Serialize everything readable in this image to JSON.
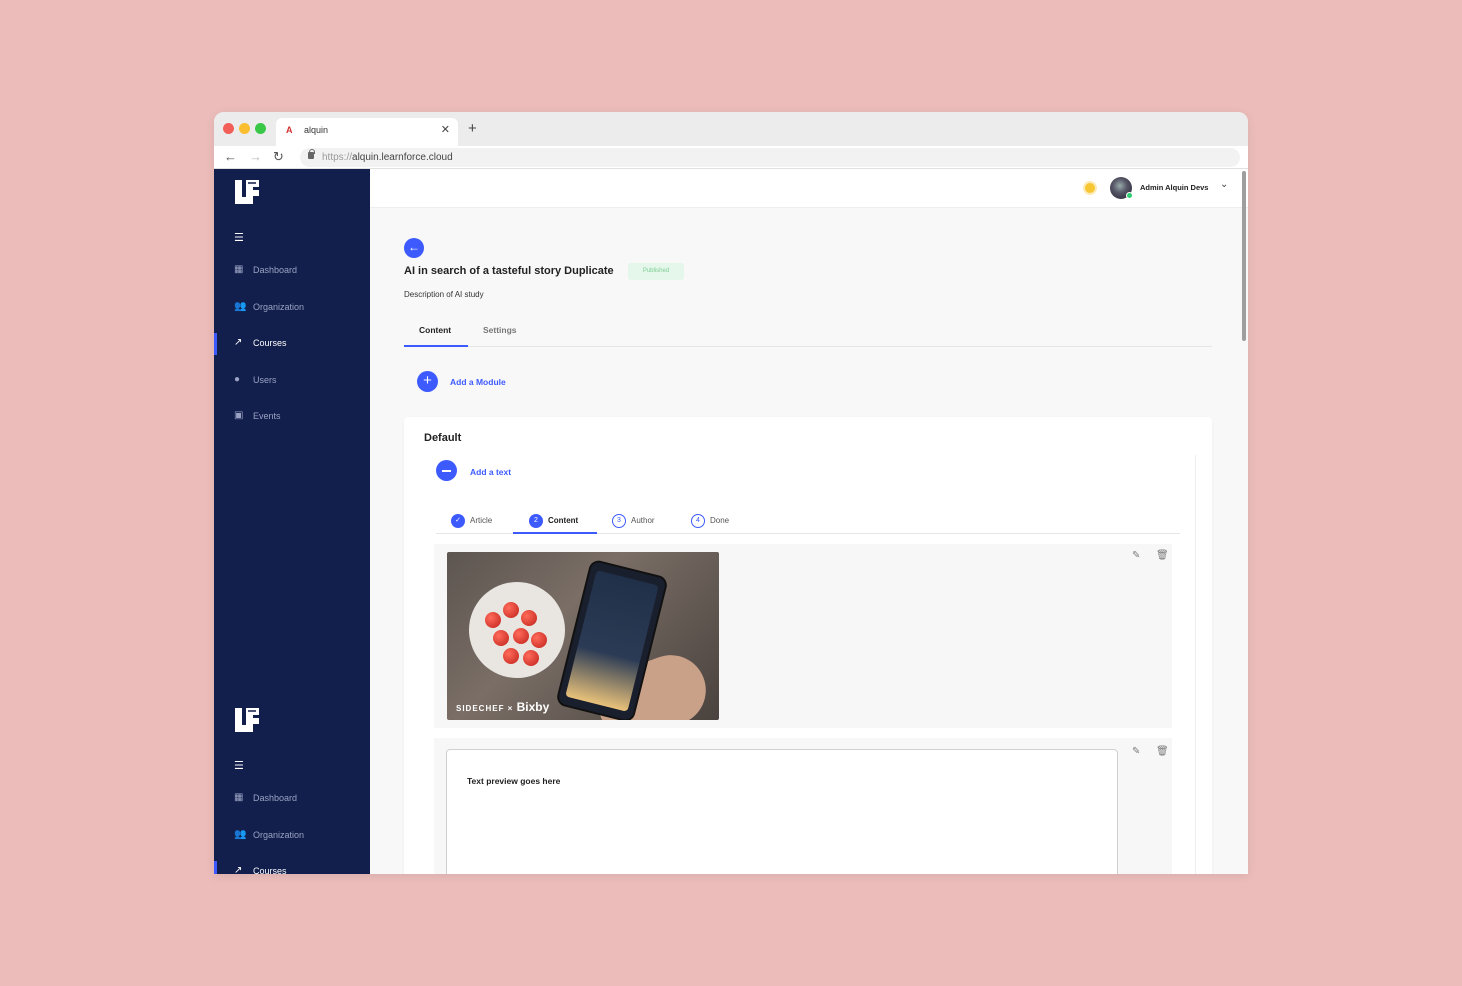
{
  "browser": {
    "tab_title": "alquin",
    "tab_favicon": "A",
    "url_protocol": "https://",
    "url_host": "alquin.learnforce.cloud"
  },
  "sidebar": {
    "items": [
      {
        "label": "Dashboard",
        "icon": "dashboard-icon"
      },
      {
        "label": "Organization",
        "icon": "people-icon"
      },
      {
        "label": "Courses",
        "icon": "trending-icon"
      },
      {
        "label": "Users",
        "icon": "person-icon"
      },
      {
        "label": "Events",
        "icon": "calendar-icon"
      }
    ],
    "items2": [
      {
        "label": "Dashboard"
      },
      {
        "label": "Organization"
      },
      {
        "label": "Courses"
      }
    ]
  },
  "topbar": {
    "user_name": "Admin Alquin Devs"
  },
  "course": {
    "title": "AI in search of a tasteful story Duplicate",
    "status": "Published",
    "description": "Description of AI study"
  },
  "page_tabs": [
    "Content",
    "Settings"
  ],
  "add_module_label": "Add a Module",
  "module": {
    "title": "Default",
    "add_text_label": "Add a text",
    "steps": [
      {
        "num": "✓",
        "label": "Article"
      },
      {
        "num": "2",
        "label": "Content"
      },
      {
        "num": "3",
        "label": "Author"
      },
      {
        "num": "4",
        "label": "Done"
      }
    ],
    "image_watermark_brand": "SIDECHEF ×",
    "image_watermark_partner": "Bixby",
    "preview_text": "Text preview goes here"
  },
  "colors": {
    "accent": "#3d5afe",
    "sidebar": "#121e4b",
    "background": "#ebbcba"
  }
}
